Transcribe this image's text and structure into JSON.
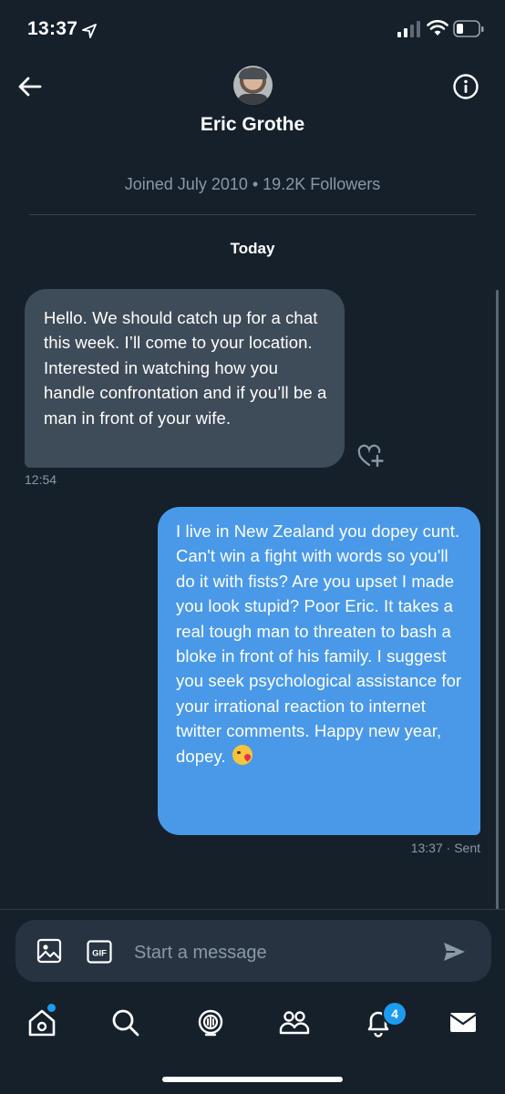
{
  "status_bar": {
    "time": "13:37"
  },
  "header": {
    "contact_name": "Eric Grothe",
    "meta": "Joined July 2010 • 19.2K Followers"
  },
  "conversation": {
    "day_label": "Today",
    "messages": [
      {
        "direction": "received",
        "text": "Hello. We should catch up for a chat this week. I’ll come to your location. Interested in watching how you handle confrontation and if you’ll be a man in front of your wife.",
        "time": "12:54"
      },
      {
        "direction": "sent",
        "text": "I live in New Zealand you dopey cunt. Can't win a fight with words so you'll do it with fists? Are you upset I made you look stupid? Poor Eric. It takes a real tough man to threaten to bash a bloke in front of his family. I suggest you seek psychological assistance for your irrational reaction to internet twitter comments. Happy new year, dopey.",
        "emoji": "face-blowing-kiss",
        "time": "13:37 · Sent"
      }
    ]
  },
  "composer": {
    "placeholder": "Start a message"
  },
  "tabbar": {
    "notifications_badge": "4"
  },
  "colors": {
    "background": "#15202b",
    "received_bubble": "#3e4b58",
    "sent_bubble": "#4a99e9",
    "accent": "#1d9bf0",
    "muted_text": "#8b98a5"
  }
}
